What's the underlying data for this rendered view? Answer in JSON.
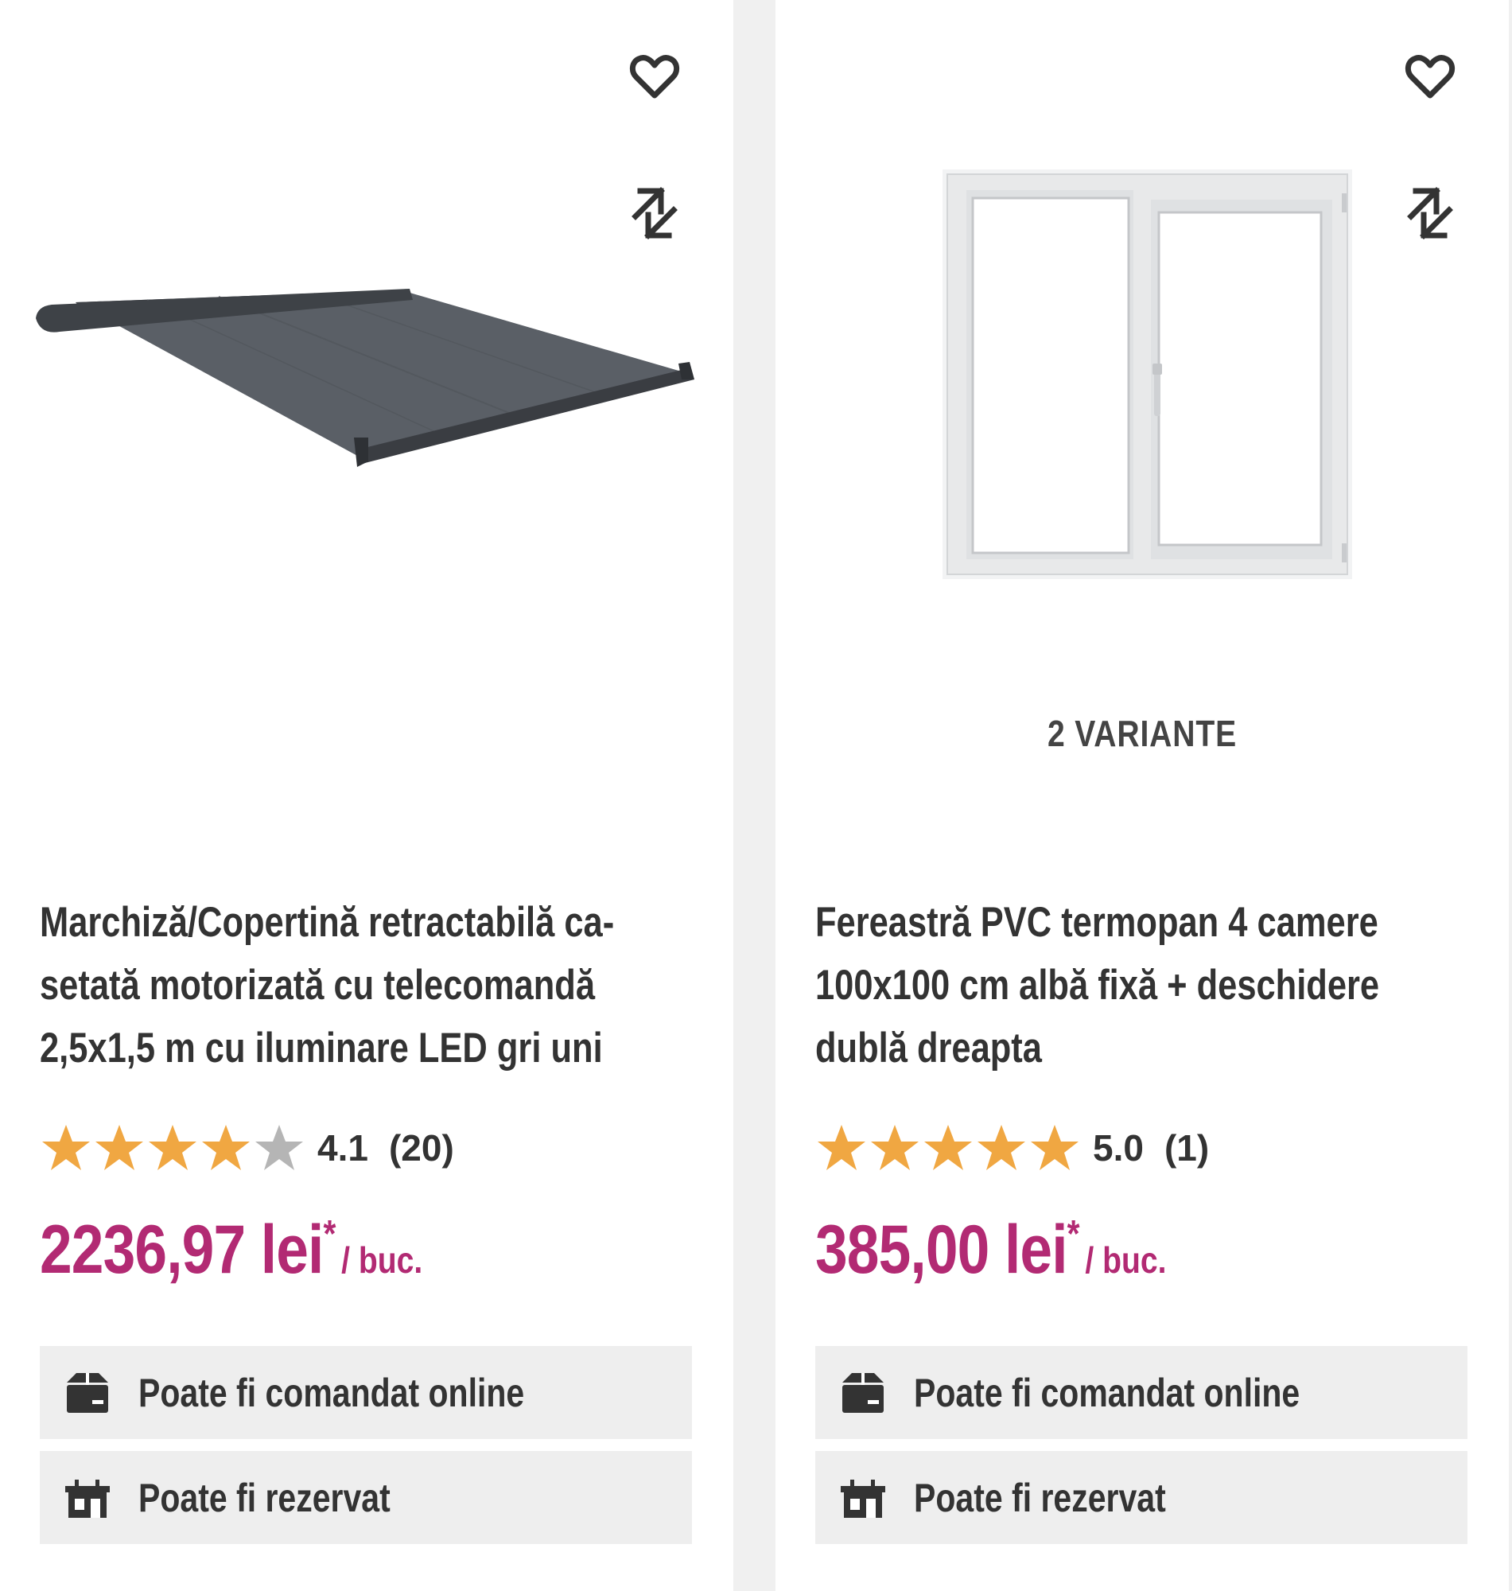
{
  "products": [
    {
      "title_lines": [
        "Marchiză/Copertină retractabilă ca-",
        "setată motorizată cu telecomandă",
        "2,5x1,5 m cu iluminare LED gri uni"
      ],
      "rating": "4.1",
      "rating_value": 4.1,
      "review_count": "(20)",
      "price": "2236,97 lei",
      "price_asterisk": "*",
      "unit": "/ buc.",
      "online_label": "Poate fi comandat online",
      "reserve_label": "Poate fi rezervat",
      "favorite_icon": "heart-icon",
      "compare_icon": "compare-arrows-icon"
    },
    {
      "variants": "2 VARIANTE",
      "title_lines": [
        "Fereastră PVC termopan 4 camere",
        "100x100 cm albă fixă + deschidere",
        "dublă dreapta"
      ],
      "rating": "5.0",
      "rating_value": 5.0,
      "review_count": "(1)",
      "price": "385,00 lei",
      "price_asterisk": "*",
      "unit": "/ buc.",
      "online_label": "Poate fi comandat online",
      "reserve_label": "Poate fi rezervat",
      "favorite_icon": "heart-icon",
      "compare_icon": "compare-arrows-icon"
    }
  ],
  "colors": {
    "price": "#b22a73",
    "star_filled": "#f0a742",
    "star_empty": "#b5b5b5",
    "info_bg": "#eeeeee",
    "page_bg": "#f0f0f0"
  }
}
